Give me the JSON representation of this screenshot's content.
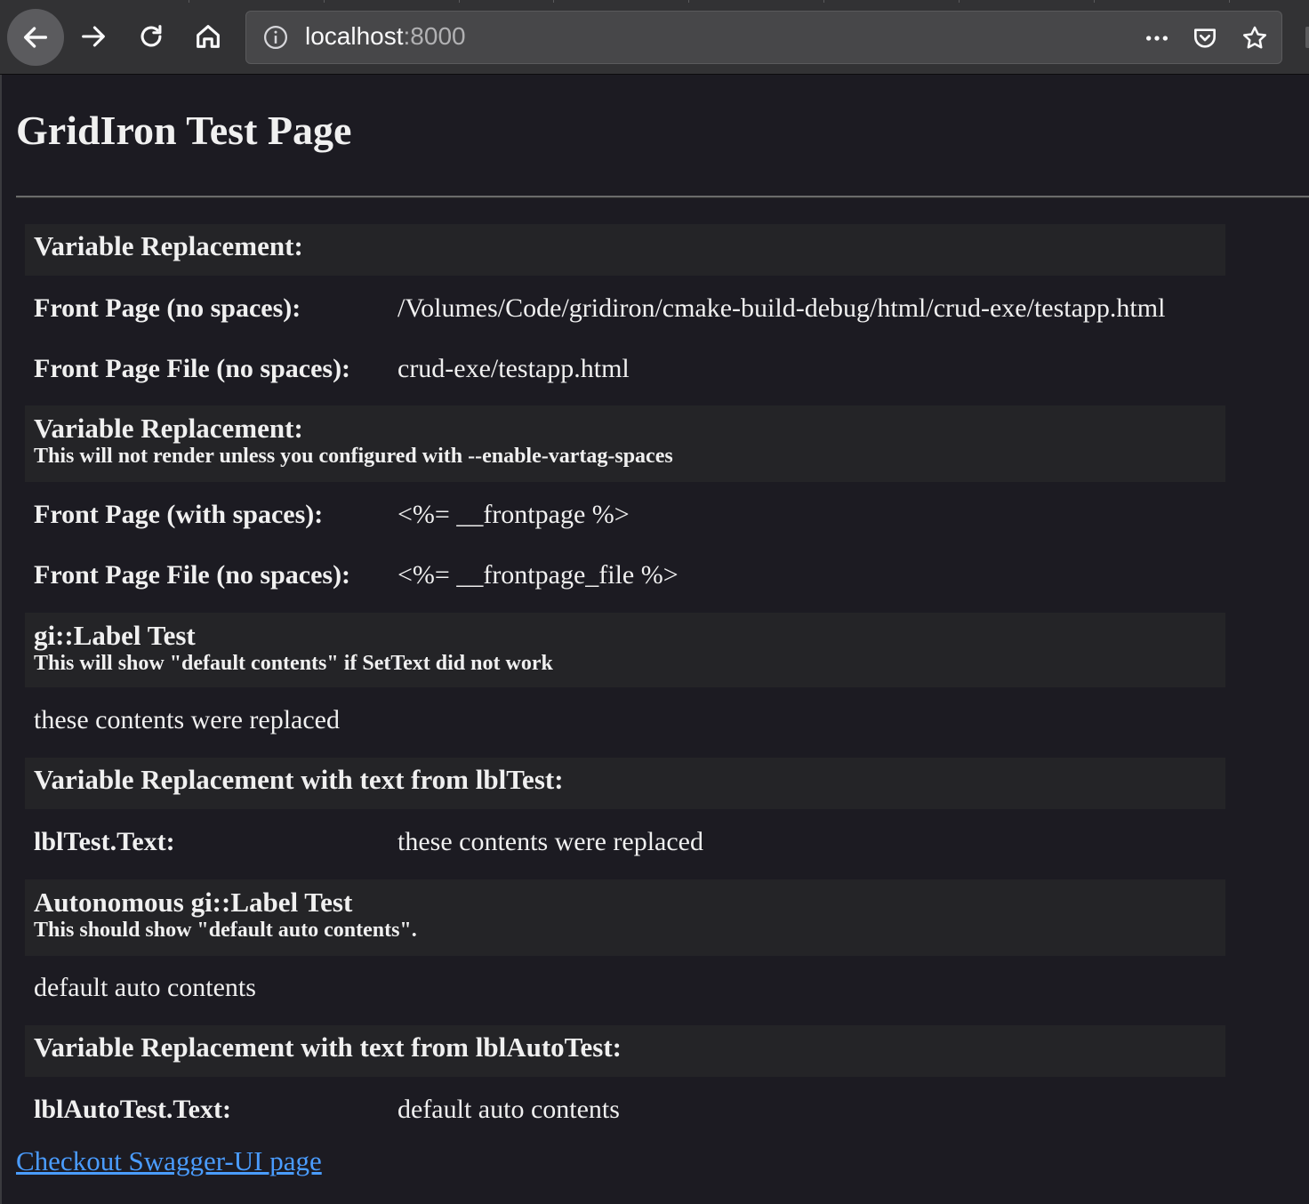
{
  "browser": {
    "url_host": "localhost",
    "url_port": ":8000"
  },
  "page": {
    "title": "GridIron Test Page",
    "sections": [
      {
        "title": "Variable Replacement:",
        "subtitle": ""
      },
      {
        "title": "Variable Replacement:",
        "subtitle": "This will not render unless you configured with --enable-vartag-spaces"
      },
      {
        "title": "gi::Label Test",
        "subtitle": "This will show \"default contents\" if SetText did not work"
      },
      {
        "title": "Variable Replacement with text from lblTest:",
        "subtitle": ""
      },
      {
        "title": "Autonomous gi::Label Test",
        "subtitle": "This should show \"default auto contents\"."
      },
      {
        "title": "Variable Replacement with text from lblAutoTest:",
        "subtitle": ""
      }
    ],
    "rows": [
      {
        "key": "Front Page (no spaces):",
        "value": "/Volumes/Code/gridiron/cmake-build-debug/html/crud-exe/testapp.html"
      },
      {
        "key": "Front Page File (no spaces):",
        "value": "crud-exe/testapp.html"
      },
      {
        "key": "Front Page (with spaces):",
        "value": "<%= __frontpage %>"
      },
      {
        "key": "Front Page File (no spaces):",
        "value": "<%= __frontpage_file %>"
      },
      {
        "key": "lblTest.Text:",
        "value": "these contents were replaced"
      },
      {
        "key": "lblAutoTest.Text:",
        "value": "default auto contents"
      }
    ],
    "label_test_output": "these contents were replaced",
    "auto_label_output": "default auto contents",
    "swagger_link": "Checkout Swagger-UI page"
  }
}
